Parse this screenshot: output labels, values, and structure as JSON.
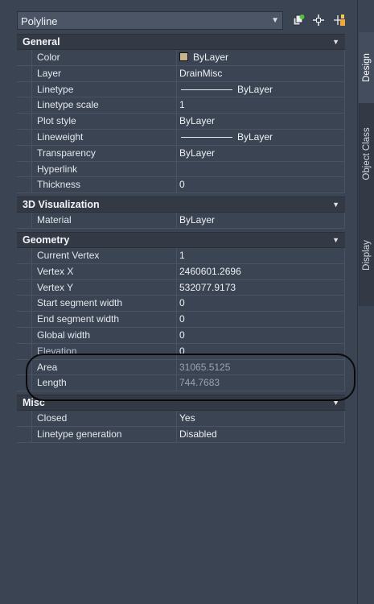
{
  "header": {
    "object_type": "Polyline",
    "icons": [
      "quick-select-icon",
      "select-objects-icon",
      "toggle-pickadd-icon"
    ]
  },
  "sections": [
    {
      "title": "General",
      "rows": [
        {
          "name": "Color",
          "value": "ByLayer",
          "swatch": "#c8b48a"
        },
        {
          "name": "Layer",
          "value": "DrainMisc"
        },
        {
          "name": "Linetype",
          "value": "ByLayer",
          "line": true
        },
        {
          "name": "Linetype scale",
          "value": "1"
        },
        {
          "name": "Plot style",
          "value": "ByLayer"
        },
        {
          "name": "Lineweight",
          "value": "ByLayer",
          "line": true
        },
        {
          "name": "Transparency",
          "value": "ByLayer"
        },
        {
          "name": "Hyperlink",
          "value": ""
        },
        {
          "name": "Thickness",
          "value": "0"
        }
      ]
    },
    {
      "title": "3D Visualization",
      "rows": [
        {
          "name": "Material",
          "value": "ByLayer"
        }
      ]
    },
    {
      "title": "Geometry",
      "rows": [
        {
          "name": "Current Vertex",
          "value": "1"
        },
        {
          "name": "Vertex X",
          "value": "2460601.2696"
        },
        {
          "name": "Vertex Y",
          "value": "532077.9173"
        },
        {
          "name": "Start segment width",
          "value": "0"
        },
        {
          "name": "End segment width",
          "value": "0"
        },
        {
          "name": "Global width",
          "value": "0"
        },
        {
          "name": "Elevation",
          "value": "0"
        },
        {
          "name": "Area",
          "value": "31065.5125",
          "readonly": true
        },
        {
          "name": "Length",
          "value": "744.7683",
          "readonly": true
        }
      ]
    },
    {
      "title": "Misc",
      "rows": [
        {
          "name": "Closed",
          "value": "Yes"
        },
        {
          "name": "Linetype generation",
          "value": "Disabled"
        }
      ]
    }
  ],
  "tabs": [
    {
      "label": "Design",
      "active": true
    },
    {
      "label": "Object Class",
      "active": false
    },
    {
      "label": "Display",
      "active": false
    }
  ]
}
